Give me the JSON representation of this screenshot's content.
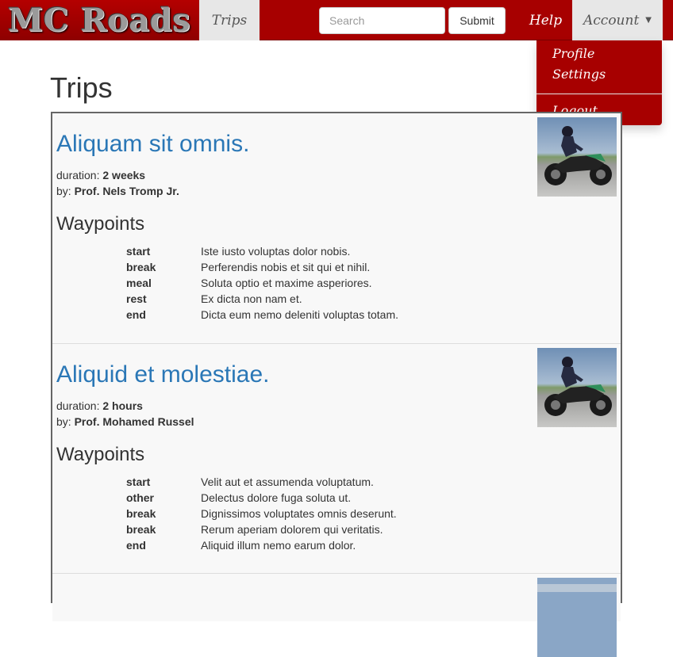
{
  "navbar": {
    "brand": "MC Roads",
    "trips_label": "Trips",
    "search_placeholder": "Search",
    "submit_label": "Submit",
    "help_label": "Help",
    "account_label": "Account",
    "accent_color": "#a70000"
  },
  "account_menu": {
    "items": [
      {
        "label": "Profile"
      },
      {
        "label": "Settings"
      },
      {
        "label": "Logout"
      }
    ]
  },
  "main": {
    "title": "Trips",
    "waypoints_heading": "Waypoints",
    "duration_label": "duration:",
    "by_label": "by:",
    "trips": [
      {
        "title": "Aliquam sit omnis.",
        "duration": "2 weeks",
        "author": "Prof. Nels Tromp Jr.",
        "waypoints": [
          {
            "type": "start",
            "description": "Iste iusto voluptas dolor nobis."
          },
          {
            "type": "break",
            "description": "Perferendis nobis et sit qui et nihil."
          },
          {
            "type": "meal",
            "description": "Soluta optio et maxime asperiores."
          },
          {
            "type": "rest",
            "description": "Ex dicta non nam et."
          },
          {
            "type": "end",
            "description": "Dicta eum nemo deleniti voluptas totam."
          }
        ]
      },
      {
        "title": "Aliquid et molestiae.",
        "duration": "2 hours",
        "author": "Prof. Mohamed Russel",
        "waypoints": [
          {
            "type": "start",
            "description": "Velit aut et assumenda voluptatum."
          },
          {
            "type": "other",
            "description": "Delectus dolore fuga soluta ut."
          },
          {
            "type": "break",
            "description": "Dignissimos voluptates omnis deserunt."
          },
          {
            "type": "break",
            "description": "Rerum aperiam dolorem qui veritatis."
          },
          {
            "type": "end",
            "description": "Aliquid illum nemo earum dolor."
          }
        ]
      }
    ]
  }
}
